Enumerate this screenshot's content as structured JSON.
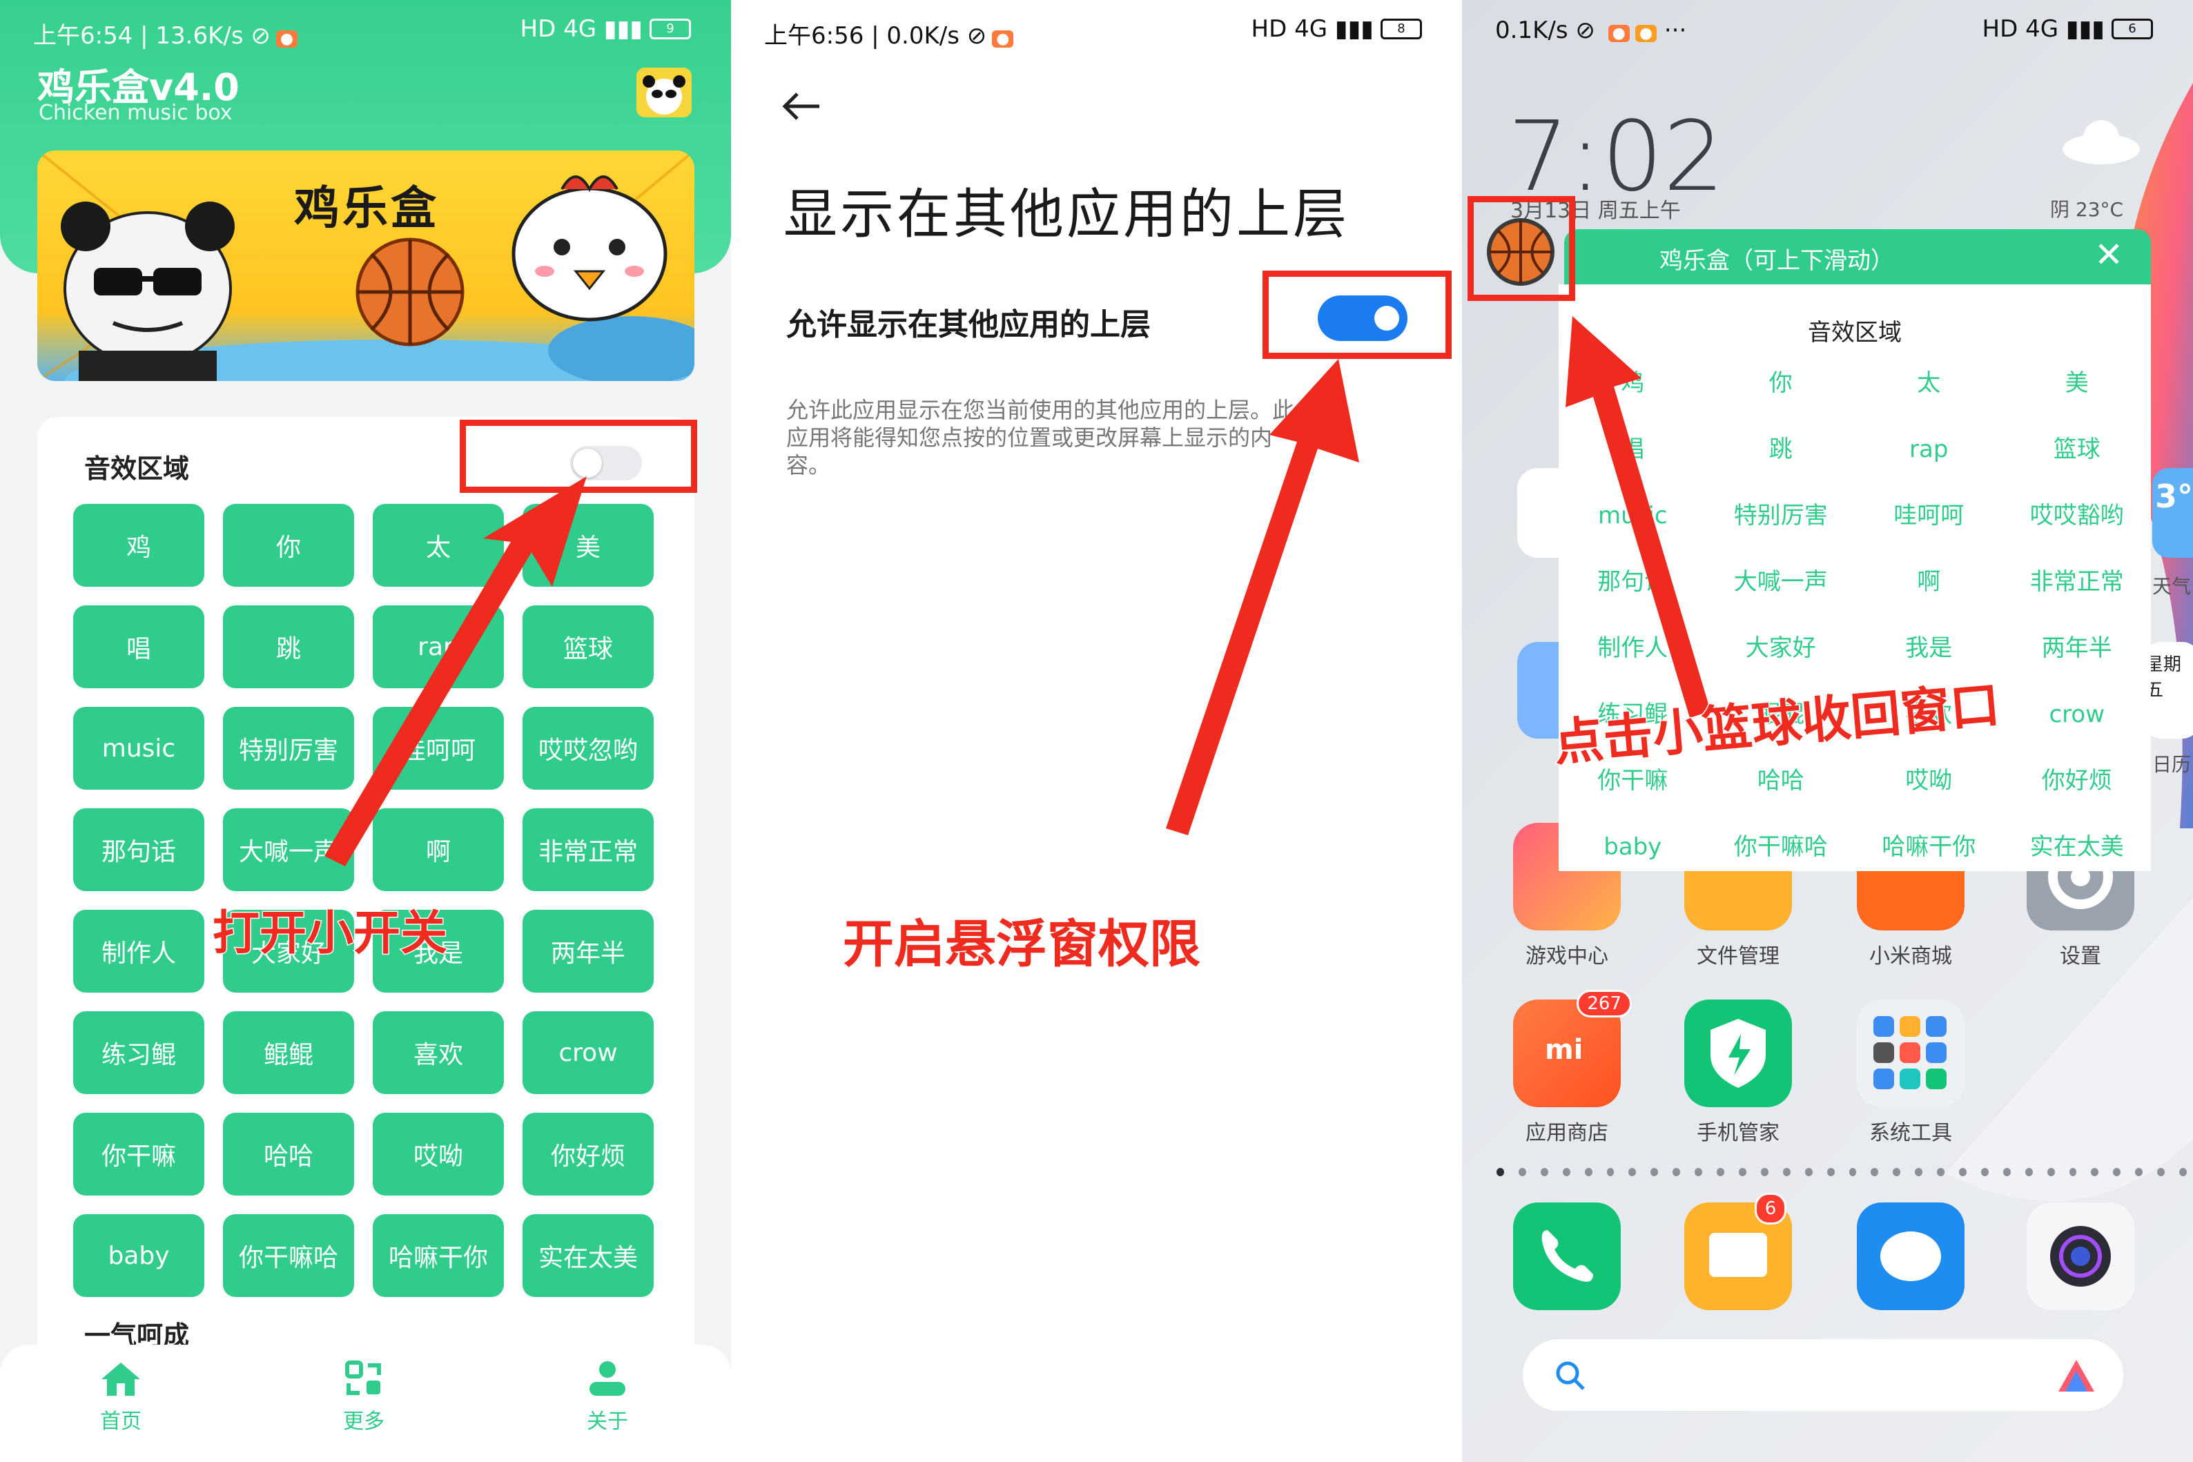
{
  "panel1": {
    "status_left": "上午6:54 | 13.6K/s",
    "app_title": "鸡乐盒v4.0",
    "app_subtitle": "Chicken music box",
    "banner_title": "鸡乐盒",
    "section_label": "音效区域",
    "buttons": [
      "鸡",
      "你",
      "太",
      "美",
      "唱",
      "跳",
      "rap",
      "篮球",
      "music",
      "特别厉害",
      "哇呵呵",
      "哎哎忽哟",
      "那句话",
      "大喊一声",
      "啊",
      "非常正常",
      "制作人",
      "大家好",
      "我是",
      "两年半",
      "练习鲲",
      "鲲鲲",
      "喜欢",
      "crow",
      "你干嘛",
      "哈哈",
      "哎呦",
      "你好烦",
      "baby",
      "你干嘛哈",
      "哈嘛干你",
      "实在太美"
    ],
    "section2_label": "一气呵成",
    "nav": [
      {
        "label": "首页"
      },
      {
        "label": "更多"
      },
      {
        "label": "关于"
      }
    ],
    "annotation": "打开小开关"
  },
  "panel2": {
    "status_left": "上午6:56 | 0.0K/s",
    "title": "显示在其他应用的上层",
    "toggle_label": "允许显示在其他应用的上层",
    "description": "允许此应用显示在您当前使用的其他应用的上层。此应用将能得知您点按的位置或更改屏幕上显示的内容。",
    "annotation": "开启悬浮窗权限"
  },
  "panel3": {
    "status_left": "0.1K/s",
    "clock": "7:02",
    "date": "3月13日 周五上午",
    "weather": "阴  23°C",
    "float_title": "鸡乐盒（可上下滑动）",
    "float_section": "音效区域",
    "float_items": [
      "鸡",
      "你",
      "太",
      "美",
      "唱",
      "跳",
      "rap",
      "篮球",
      "music",
      "特别厉害",
      "哇呵呵",
      "哎哎豁哟",
      "那句话",
      "大喊一声",
      "啊",
      "非常正常",
      "制作人",
      "大家好",
      "我是",
      "两年半",
      "练习鲲",
      "鲲鲲",
      "喜欢",
      "crow",
      "你干嘛",
      "哈哈",
      "哎呦",
      "你好烦",
      "baby",
      "你干嘛哈",
      "哈嘛干你",
      "实在太美"
    ],
    "annotation": "点击小篮球收回窗口",
    "apps_row1": [
      {
        "label": "游戏中心"
      },
      {
        "label": "文件管理"
      },
      {
        "label": "小米商城"
      },
      {
        "label": "设置"
      }
    ],
    "apps_row2": [
      {
        "label": "应用商店",
        "badge": "267"
      },
      {
        "label": "手机管家"
      },
      {
        "label": "系统工具"
      }
    ],
    "dock_badge": "6",
    "side_text_1": "3°",
    "side_text_2": "天气",
    "side_text_3": "星期五",
    "side_text_4": "日历"
  },
  "colors": {
    "brand_green": "#2fcc8c",
    "annotation_red": "#ef2a1f",
    "toggle_blue": "#1a7cf0"
  }
}
